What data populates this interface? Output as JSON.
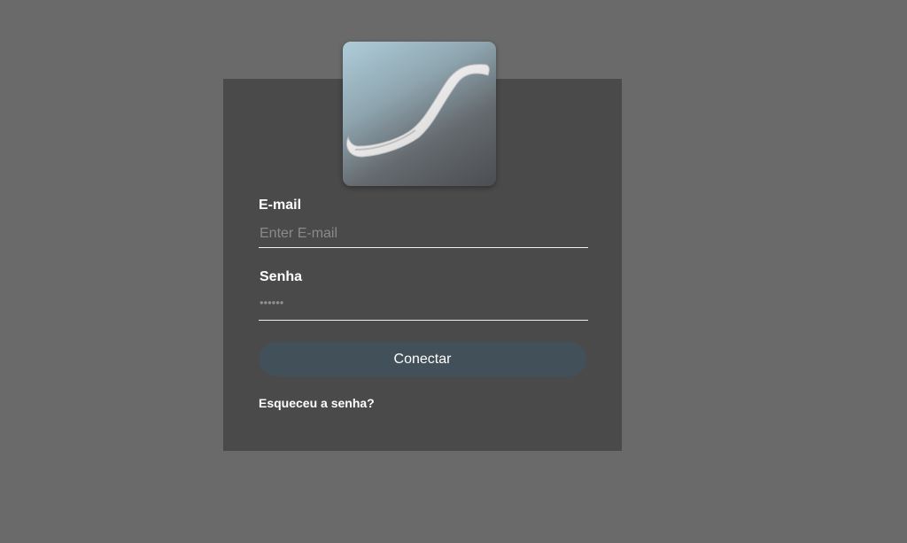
{
  "colors": {
    "page_background": "#6a6a6a",
    "card_background": "#4a4a4a",
    "button_background": "#415059",
    "text": "#ffffff"
  },
  "logo": {
    "icon": "swoosh-logo-icon"
  },
  "form": {
    "email_label": "E-mail",
    "email_placeholder": "Enter E-mail",
    "email_value": "",
    "password_label": "Senha",
    "password_mask": "••••••",
    "submit_label": "Conectar",
    "forgot_label": "Esqueceu a senha?"
  }
}
